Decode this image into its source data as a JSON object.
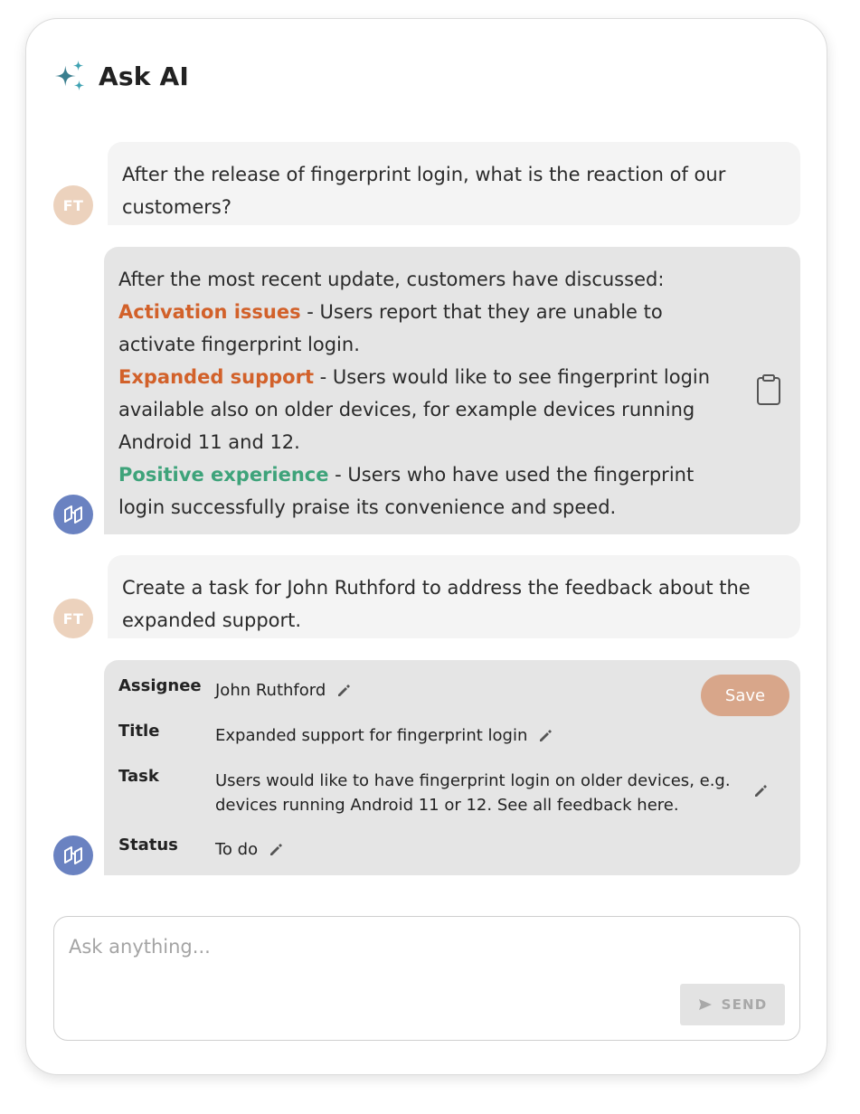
{
  "header": {
    "title": "Ask AI",
    "icon": "sparkles-icon"
  },
  "messages": [
    {
      "role": "user",
      "avatar": "FT",
      "text": "After the release of fingerprint login, what is the reaction of our customers?"
    },
    {
      "role": "assistant",
      "intro": "After the most recent update, customers have discussed:",
      "topics": [
        {
          "label": "Activation issues",
          "text": " - Users report that they are unable to activate fingerprint login.",
          "color": "#d2612a"
        },
        {
          "label": "Expanded support",
          "text": " - Users would like to see fingerprint login available also on older devices, for example devices running Android 11 and 12.",
          "color": "#d2612a"
        },
        {
          "label": "Positive experience",
          "text": " - Users who have used the fingerprint login successfully praise its convenience and speed.",
          "color": "#3ea37a"
        }
      ]
    },
    {
      "role": "user",
      "avatar": "FT",
      "text": "Create a task for John Ruthford to address the feedback about the expanded support."
    },
    {
      "role": "assistant",
      "task": {
        "assignee_label": "Assignee",
        "assignee": "John Ruthford",
        "title_label": "Title",
        "title": "Expanded support for fingerprint login",
        "task_label": "Task",
        "task_line1": "Users would like to have fingerprint login on older devices, e.g.",
        "task_line2": "devices running Android 11 or 12. See all feedback here.",
        "status_label": "Status",
        "status": "To do",
        "save_label": "Save"
      }
    }
  ],
  "composer": {
    "placeholder": "Ask anything...",
    "send_label": "SEND"
  },
  "colors": {
    "user_avatar": "#ecd2bd",
    "bot_avatar": "#6a82c1",
    "save_button": "#d8a68a"
  }
}
